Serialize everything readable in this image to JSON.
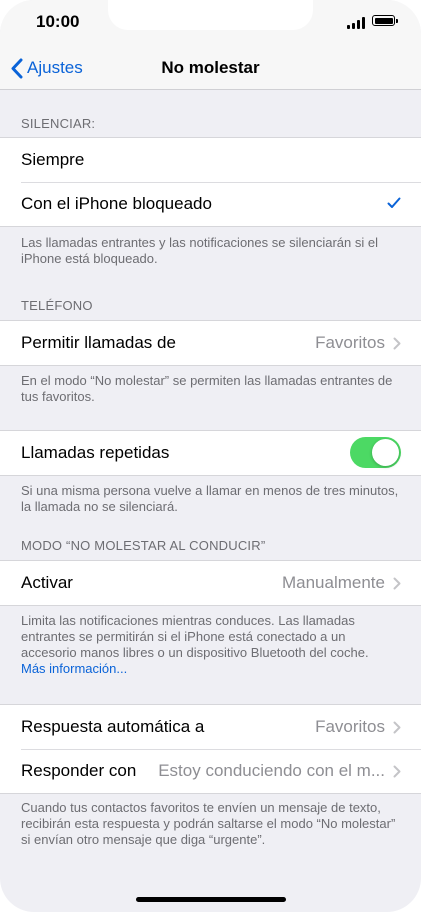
{
  "status_bar": {
    "time": "10:00"
  },
  "nav": {
    "back_label": "Ajustes",
    "title": "No molestar"
  },
  "silence": {
    "header": "SILENCIAR:",
    "options": [
      {
        "label": "Siempre",
        "selected": false
      },
      {
        "label": "Con el iPhone bloqueado",
        "selected": true
      }
    ],
    "footer": "Las llamadas entrantes y las notificaciones se silenciarán si el iPhone está bloqueado."
  },
  "phone": {
    "header": "TELÉFONO",
    "allow_calls": {
      "label": "Permitir llamadas de",
      "value": "Favoritos"
    },
    "footer": "En el modo “No molestar” se permiten las llamadas entrantes de tus favoritos."
  },
  "repeated_calls": {
    "label": "Llamadas repetidas",
    "enabled": true,
    "footer": "Si una misma persona vuelve a llamar en menos de tres minutos, la llamada no se silenciará."
  },
  "driving": {
    "header": "MODO “NO MOLESTAR AL CONDUCIR”",
    "activate": {
      "label": "Activar",
      "value": "Manualmente"
    },
    "footer": "Limita las notificaciones mientras conduces. Las llamadas entrantes se permitirán si el iPhone está conectado a un accesorio manos libres o un dispositivo Bluetooth del coche.",
    "more_info": "Más información..."
  },
  "auto_reply": {
    "reply_to": {
      "label": "Respuesta automática a",
      "value": "Favoritos"
    },
    "reply_with": {
      "label": "Responder con",
      "value": "Estoy conduciendo con el m..."
    },
    "footer": "Cuando tus contactos favoritos te envíen un mensaje de texto, recibirán esta respuesta y podrán saltarse el modo “No molestar” si envían otro mensaje que diga “urgente”."
  },
  "colors": {
    "accent": "#0a63d8",
    "toggle_on": "#4cd964"
  }
}
